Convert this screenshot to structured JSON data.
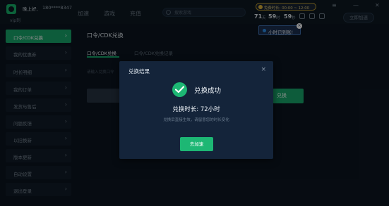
{
  "header": {
    "user_name": "晚上好,",
    "user_phone": "180****8347",
    "vip_label": "vip到",
    "nav_tabs": [
      "加速",
      "游戏",
      "充值"
    ],
    "search_placeholder": "搜索游戏",
    "status_text": "免费时长: 00:00 ~ 12:00",
    "window_buttons": [
      "≡",
      "—",
      "✕"
    ],
    "counters": [
      {
        "value": "71",
        "unit": "天"
      },
      {
        "value": "59",
        "unit": "时"
      },
      {
        "value": "59",
        "unit": "秒"
      }
    ],
    "speed_button": "立即加速",
    "tooltip": "小时已到账!"
  },
  "sidebar": {
    "items": [
      {
        "label": "口令/CDK兑换",
        "active": true
      },
      {
        "label": "我的优惠券",
        "active": false
      },
      {
        "label": "时长明细",
        "active": false
      },
      {
        "label": "我的订单",
        "active": false
      },
      {
        "label": "发货与售后",
        "active": false
      },
      {
        "label": "问题反馈",
        "active": false
      },
      {
        "label": "以旧换新",
        "active": false
      },
      {
        "label": "版本更新",
        "active": false
      },
      {
        "label": "自动设置",
        "active": false
      },
      {
        "label": "退出登录",
        "active": false
      }
    ]
  },
  "main": {
    "title": "口令/CDK兑换",
    "sub_tabs": [
      {
        "label": "口令/CDK兑换",
        "active": true
      },
      {
        "label": "口令/CDK兑换记录",
        "active": false
      }
    ],
    "hint": "请输入兑换口令",
    "redeem_button": "兑换"
  },
  "modal": {
    "title": "兑换结果",
    "close_symbol": "×",
    "success": "兑换成功",
    "duration": "兑换时长: 72小时",
    "note": "兑换后直接生效，请留意您的时长变化",
    "confirm_button": "去加速"
  },
  "colors": {
    "accent": "#19a86c",
    "background": "#0c1520",
    "modal": "#14243a",
    "tooltip": "#1d3150"
  }
}
